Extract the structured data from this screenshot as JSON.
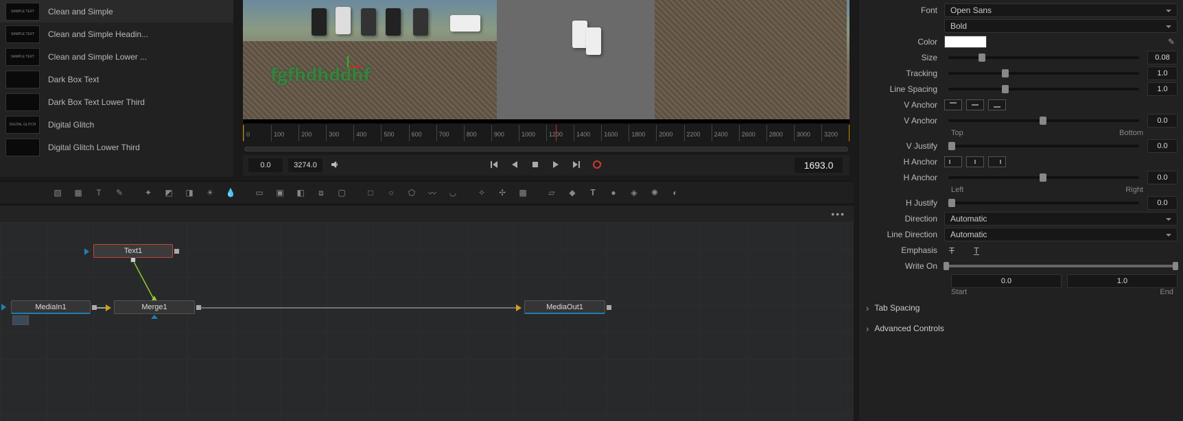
{
  "presets": [
    {
      "label": "Clean and Simple",
      "thumb": "SAMPLE TEXT"
    },
    {
      "label": "Clean and Simple Headin...",
      "thumb": "SAMPLE TEXT"
    },
    {
      "label": "Clean and Simple Lower ...",
      "thumb": "SAMPLE TEXT"
    },
    {
      "label": "Dark Box Text",
      "thumb": ""
    },
    {
      "label": "Dark Box Text Lower Third",
      "thumb": ""
    },
    {
      "label": "Digital Glitch",
      "thumb": "DIGITAL GLITCH"
    },
    {
      "label": "Digital Glitch Lower Third",
      "thumb": ""
    }
  ],
  "viewer": {
    "overlay_text": "fgfhdhddhf"
  },
  "ruler_ticks": [
    "0",
    "100",
    "200",
    "300",
    "400",
    "500",
    "600",
    "700",
    "800",
    "900",
    "1000",
    "1200",
    "1400",
    "1600",
    "1800",
    "2000",
    "2200",
    "2400",
    "2600",
    "2800",
    "3000",
    "3200"
  ],
  "transport": {
    "tc_left1": "0.0",
    "tc_left2": "3274.0",
    "tc_right": "1693.0"
  },
  "nodes": {
    "text1": "Text1",
    "mediain": "MediaIn1",
    "merge": "Merge1",
    "mediaout": "MediaOut1"
  },
  "inspector": {
    "font_label": "Font",
    "font_value": "Open Sans",
    "font_weight": "Bold",
    "color_label": "Color",
    "size_label": "Size",
    "size_value": "0.08",
    "tracking_label": "Tracking",
    "tracking_value": "1.0",
    "linespacing_label": "Line Spacing",
    "linespacing_value": "1.0",
    "vanchor_label": "V Anchor",
    "vanchor2_label": "V Anchor",
    "vanchor2_value": "0.0",
    "vanchor_top": "Top",
    "vanchor_bottom": "Bottom",
    "vjustify_label": "V Justify",
    "vjustify_value": "0.0",
    "hanchor_label": "H Anchor",
    "hanchor2_label": "H Anchor",
    "hanchor2_value": "0.0",
    "hanchor_left": "Left",
    "hanchor_right": "Right",
    "hjustify_label": "H Justify",
    "hjustify_value": "0.0",
    "direction_label": "Direction",
    "direction_value": "Automatic",
    "linedir_label": "Line Direction",
    "linedir_value": "Automatic",
    "emphasis_label": "Emphasis",
    "writeon_label": "Write On",
    "writeon_start": "0.0",
    "writeon_end": "1.0",
    "writeon_start_lbl": "Start",
    "writeon_end_lbl": "End",
    "tabspacing": "Tab Spacing",
    "advanced": "Advanced Controls"
  }
}
